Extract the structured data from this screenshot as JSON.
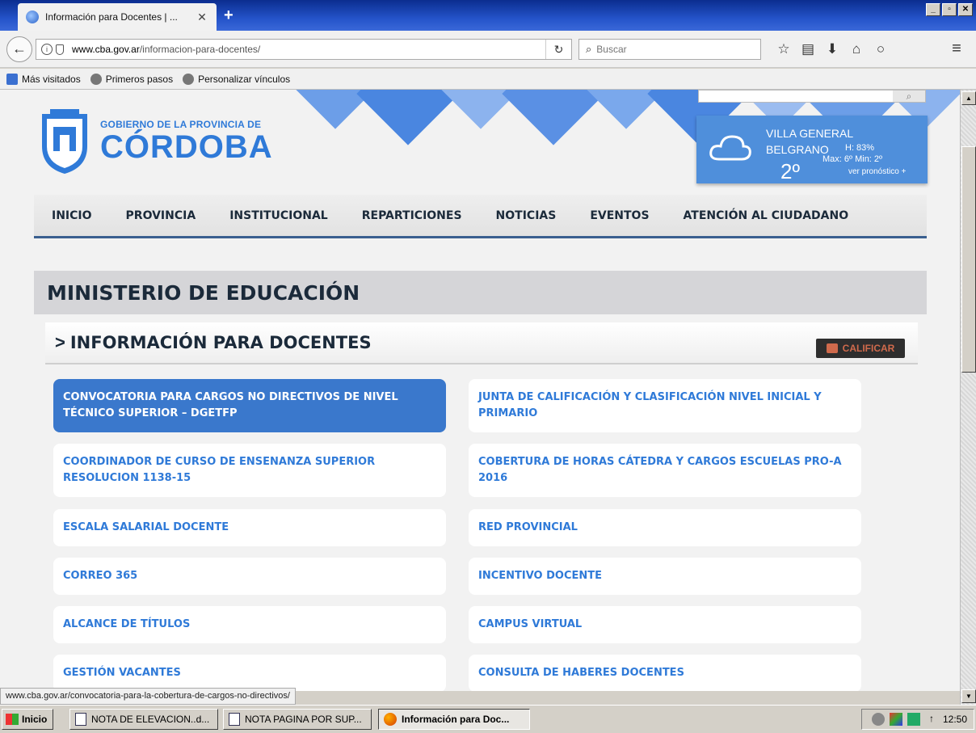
{
  "browser": {
    "tab_title": "Información para Docentes | ...",
    "tab_close": "✕",
    "new_tab": "+",
    "window_buttons": [
      "_",
      "▫",
      "✕"
    ],
    "url_domain": "www.cba.gov.ar",
    "url_path": "/informacion-para-docentes/",
    "search_placeholder": "Buscar",
    "bookmarks": [
      "Más visitados",
      "Primeros pasos",
      "Personalizar vínculos"
    ],
    "status_url": "www.cba.gov.ar/convocatoria-para-la-cobertura-de-cargos-no-directivos/"
  },
  "site": {
    "logo_small": "GOBIERNO DE LA PROVINCIA DE",
    "logo_big": "CÓRDOBA",
    "weather": {
      "city": "VILLA GENERAL BELGRANO",
      "humidity": "H: 83%",
      "minmax": "Max: 6º Min: 2º",
      "temp": "2º",
      "forecast": "ver pronóstico +"
    },
    "nav": [
      "INICIO",
      "PROVINCIA",
      "INSTITUCIONAL",
      "REPARTICIONES",
      "NOTICIAS",
      "EVENTOS",
      "ATENCIÓN AL CIUDADANO"
    ],
    "ministry_title": "MINISTERIO DE EDUCACIÓN",
    "section_chevron": ">",
    "section_title": "INFORMACIÓN PARA DOCENTES",
    "rate_button": "CALIFICAR",
    "links": [
      "CONVOCATORIA PARA CARGOS NO DIRECTIVOS DE NIVEL TÉCNICO SUPERIOR – DGETFP",
      "JUNTA DE CALIFICACIÓN Y CLASIFICACIÓN NIVEL INICIAL Y PRIMARIO",
      "COORDINADOR DE CURSO DE ENSENANZA SUPERIOR RESOLUCION 1138-15",
      "COBERTURA DE HORAS CÁTEDRA Y CARGOS ESCUELAS PRO-A 2016",
      "ESCALA SALARIAL DOCENTE",
      "RED PROVINCIAL",
      "CORREO 365",
      "INCENTIVO DOCENTE",
      "ALCANCE DE TÍTULOS",
      "CAMPUS VIRTUAL",
      "GESTIÓN VACANTES",
      "CONSULTA DE HABERES DOCENTES"
    ]
  },
  "taskbar": {
    "start": "Inicio",
    "items": [
      "NOTA DE ELEVACION..d...",
      "NOTA PAGINA POR SUP...",
      "Información para Doc..."
    ],
    "clock": "12:50"
  },
  "colors": {
    "brand_blue": "#2f7ad8",
    "active_link": "#3a78cc",
    "nav_text": "#1b2a3a"
  }
}
